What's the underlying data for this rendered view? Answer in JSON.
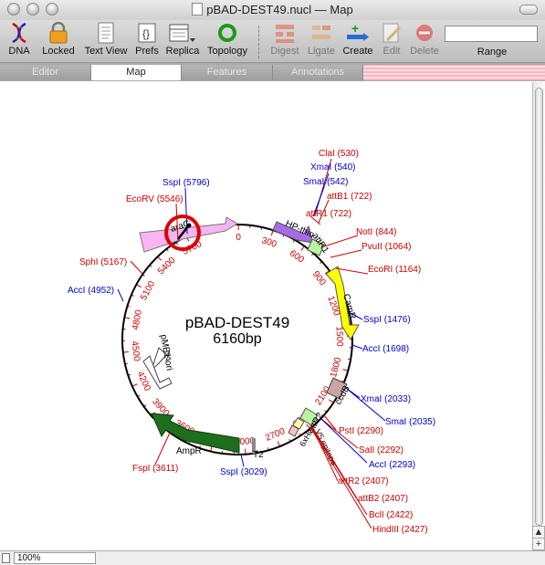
{
  "window": {
    "title": "pBAD-DEST49.nucl — Map"
  },
  "toolbar": {
    "items": [
      {
        "label": "DNA"
      },
      {
        "label": "Locked"
      },
      {
        "label": "Text View"
      },
      {
        "label": "Prefs"
      },
      {
        "label": "Replica"
      },
      {
        "label": "Topology"
      },
      {
        "label": "Digest"
      },
      {
        "label": "Ligate"
      },
      {
        "label": "Create"
      },
      {
        "label": "Edit"
      },
      {
        "label": "Delete"
      }
    ],
    "range_label": "Range",
    "range_value": ""
  },
  "tabs": [
    {
      "label": "Editor"
    },
    {
      "label": "Map"
    },
    {
      "label": "Features"
    },
    {
      "label": "Annotations"
    }
  ],
  "map": {
    "name": "pBAD-DEST49",
    "length": "6160bp",
    "ticks": [
      "0",
      "300",
      "600",
      "900",
      "1200",
      "1500",
      "1800",
      "2100",
      "2400",
      "2700",
      "3000",
      "3300",
      "3600",
      "3900",
      "4200",
      "4500",
      "4800",
      "5100",
      "5400",
      "5700"
    ],
    "features": [
      "araC",
      "HP-thio",
      "attR1",
      "CamR",
      "ccdB",
      "attR2",
      "6xHis",
      "V5 epitope",
      "T2",
      "AmpR",
      "pMB1 ori"
    ],
    "sites": [
      {
        "label": "ClaI (530)"
      },
      {
        "label": "XmaI (540)"
      },
      {
        "label": "SmaI (542)"
      },
      {
        "label": "attB1 (722)"
      },
      {
        "label": "attR1 (722)"
      },
      {
        "label": "NotI (844)"
      },
      {
        "label": "PvuII (1064)"
      },
      {
        "label": "EcoRI (1164)"
      },
      {
        "label": "SspI (1476)"
      },
      {
        "label": "AccI (1698)"
      },
      {
        "label": "XmaI (2033)"
      },
      {
        "label": "SmaI (2035)"
      },
      {
        "label": "PstI (2290)"
      },
      {
        "label": "SalI (2292)"
      },
      {
        "label": "AccI (2293)"
      },
      {
        "label": "attR2 (2407)"
      },
      {
        "label": "attB2 (2407)"
      },
      {
        "label": "BclI (2422)"
      },
      {
        "label": "HindIII (2427)"
      },
      {
        "label": "SspI (3029)"
      },
      {
        "label": "FspI (3611)"
      },
      {
        "label": "AccI (4952)"
      },
      {
        "label": "SphI (5167)"
      },
      {
        "label": "EcoRV (5546)"
      },
      {
        "label": "SspI (5796)"
      }
    ]
  },
  "status": {
    "zoom": "100%"
  },
  "colors": {
    "red": "#cc0000",
    "blue": "#0000cc"
  }
}
